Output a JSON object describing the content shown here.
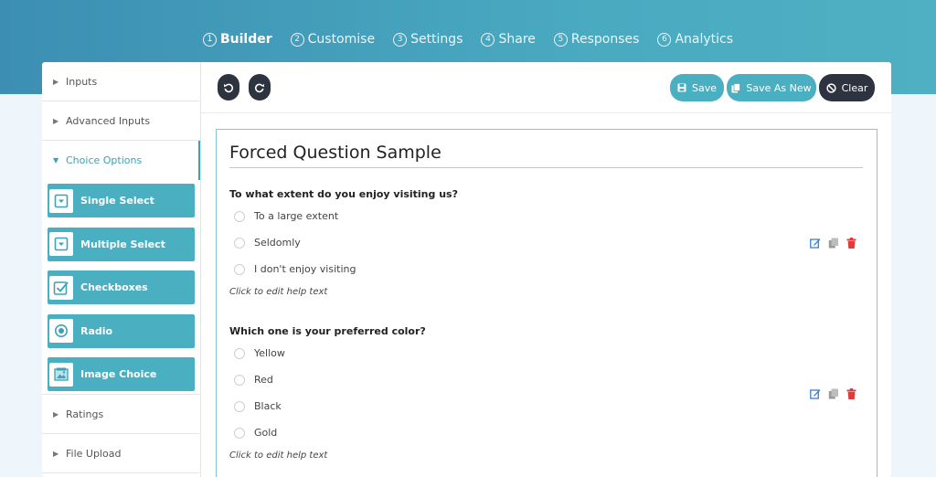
{
  "steps": [
    {
      "num": "1",
      "label": "Builder"
    },
    {
      "num": "2",
      "label": "Customise"
    },
    {
      "num": "3",
      "label": "Settings"
    },
    {
      "num": "4",
      "label": "Share"
    },
    {
      "num": "5",
      "label": "Responses"
    },
    {
      "num": "6",
      "label": "Analytics"
    }
  ],
  "sidebar": {
    "inputs": "Inputs",
    "advanced_inputs": "Advanced Inputs",
    "choice_options": "Choice Options",
    "choices": [
      {
        "label": "Single Select",
        "icon": "dropdown-icon"
      },
      {
        "label": "Multiple Select",
        "icon": "dropdown-icon"
      },
      {
        "label": "Checkboxes",
        "icon": "checkbox-icon"
      },
      {
        "label": "Radio",
        "icon": "radio-icon"
      },
      {
        "label": "Image Choice",
        "icon": "image-icon"
      }
    ],
    "ratings": "Ratings",
    "file_upload": "File Upload"
  },
  "toolbar": {
    "save": "Save",
    "save_as_new": "Save As New",
    "clear": "Clear"
  },
  "form": {
    "title": "Forced Question Sample",
    "questions": [
      {
        "label": "To what extent do you enjoy visiting us?",
        "options": [
          "To a large extent",
          "Seldomly",
          "I don't enjoy visiting"
        ],
        "help": "Click to edit help text"
      },
      {
        "label": "Which one is your preferred color?",
        "options": [
          "Yellow",
          "Red",
          "Black",
          "Gold"
        ],
        "help": "Click to edit help text"
      }
    ]
  },
  "colors": {
    "accent": "#4ab0c1",
    "dark_button": "#2e3340",
    "edit_icon": "#3a7ecb",
    "delete_icon": "#e03b3b"
  }
}
